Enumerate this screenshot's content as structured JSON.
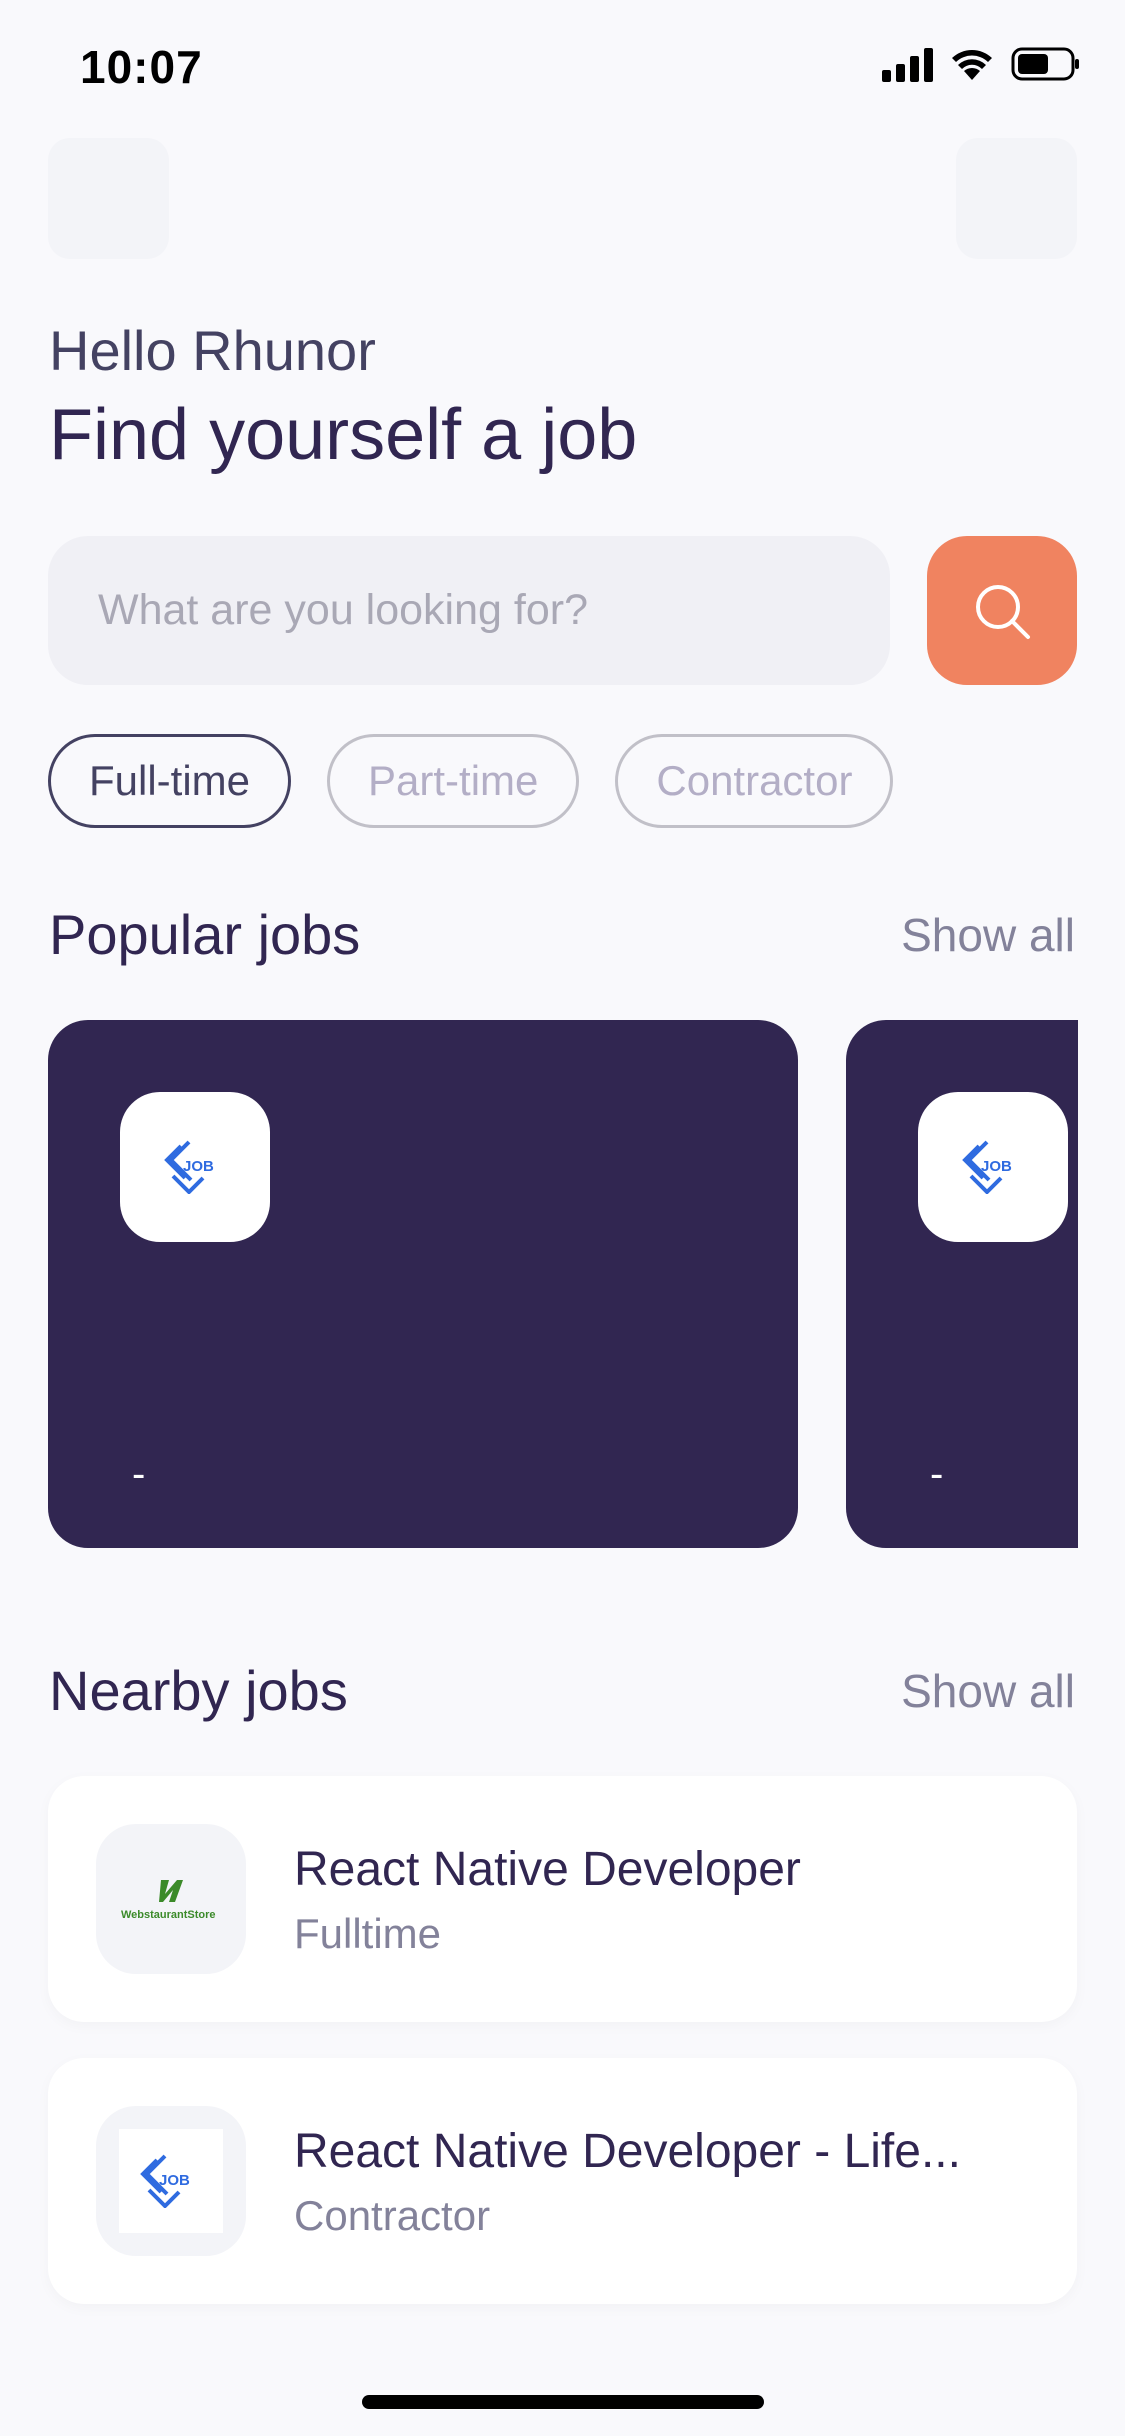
{
  "status_bar": {
    "time": "10:07"
  },
  "welcome": {
    "greeting": "Hello Rhunor",
    "headline": "Find yourself a job"
  },
  "search": {
    "placeholder": "What are you looking for?",
    "button_icon": "search-icon"
  },
  "tabs": [
    {
      "label": "Full-time",
      "active": true
    },
    {
      "label": "Part-time",
      "active": false
    },
    {
      "label": "Contractor",
      "active": false
    }
  ],
  "popular": {
    "title": "Popular jobs",
    "show_all": "Show all",
    "cards": [
      {
        "logo_text": "JOB",
        "subtitle": "-"
      },
      {
        "logo_text": "JOB",
        "subtitle": "-"
      }
    ]
  },
  "nearby": {
    "title": "Nearby jobs",
    "show_all": "Show all",
    "items": [
      {
        "title": "React Native Developer",
        "type": "Fulltime",
        "logo": "WebstaurantStore"
      },
      {
        "title": "React Native Developer - Life...",
        "type": "Contractor",
        "logo": "JOB"
      }
    ]
  },
  "colors": {
    "background": "#F9F9FC",
    "primary": "#312651",
    "accent": "#F08360",
    "muted": "#83829A"
  }
}
